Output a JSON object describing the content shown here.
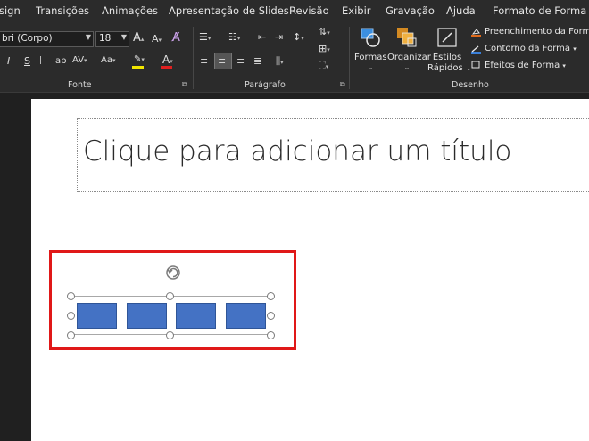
{
  "tabs": [
    "sign",
    "Transições",
    "Animações",
    "Apresentação de Slides",
    "Revisão",
    "Exibir",
    "Gravação",
    "Ajuda",
    "Formato de Forma"
  ],
  "font_group": {
    "label": "Fonte",
    "font_name": "bri (Corpo)",
    "font_size": "18",
    "italic": "I",
    "strike": "S",
    "strikethrough": "ab",
    "spacing": "AV",
    "case": "Aa",
    "highlight": "ab",
    "font_color": "A",
    "grow": "A",
    "shrink": "A"
  },
  "paragraph_group": {
    "label": "Parágrafo"
  },
  "drawing_group": {
    "label": "Desenho",
    "shapes_label": "Formas",
    "arrange_label": "Organizar",
    "quick_styles_label_1": "Estilos",
    "quick_styles_label_2": "Rápidos",
    "fill_label": "Preenchimento da Forma",
    "outline_label": "Contorno da Forma",
    "effects_label": "Efeitos de Forma"
  },
  "slide": {
    "title_placeholder": "Clique para adicionar um título"
  },
  "colors": {
    "ribbon_bg": "#2b2b2b",
    "shape_fill": "#4472c4",
    "shape_border": "#2f5597",
    "highlight_bar": "#f2e600",
    "font_color_bar": "#e02020",
    "selection_outline": "#e01818"
  }
}
